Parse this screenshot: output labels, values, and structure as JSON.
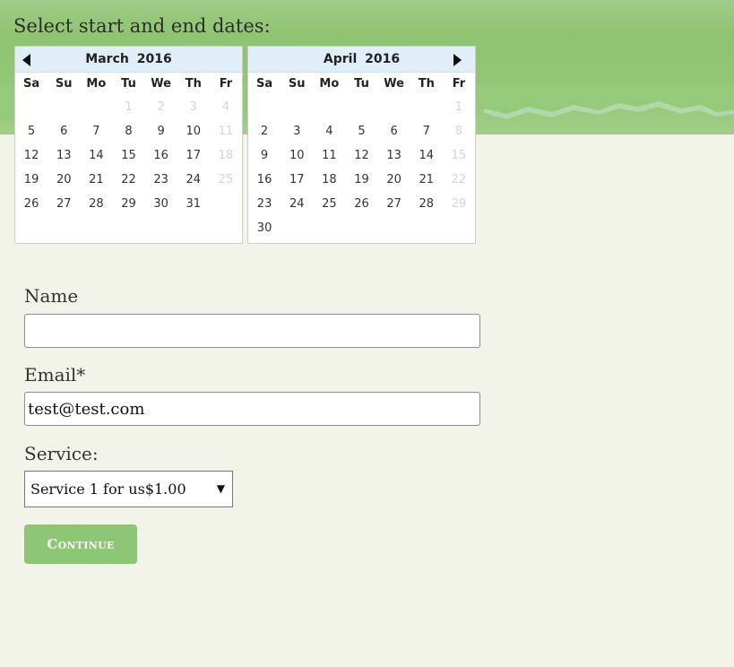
{
  "header": {
    "title": "Select start and end dates:"
  },
  "calendars": [
    {
      "month_label": "March  2016",
      "weekdays": [
        "Sa",
        "Su",
        "Mo",
        "Tu",
        "We",
        "Th",
        "Fr"
      ],
      "rows": [
        [
          {
            "t": "",
            "s": "empty"
          },
          {
            "t": "",
            "s": "empty"
          },
          {
            "t": "",
            "s": "empty"
          },
          {
            "t": "1",
            "s": "dim"
          },
          {
            "t": "2",
            "s": "dim"
          },
          {
            "t": "3",
            "s": "dim"
          },
          {
            "t": "4",
            "s": "dim"
          }
        ],
        [
          {
            "t": "5",
            "s": ""
          },
          {
            "t": "6",
            "s": ""
          },
          {
            "t": "7",
            "s": ""
          },
          {
            "t": "8",
            "s": ""
          },
          {
            "t": "9",
            "s": ""
          },
          {
            "t": "10",
            "s": ""
          },
          {
            "t": "11",
            "s": "dim"
          }
        ],
        [
          {
            "t": "12",
            "s": ""
          },
          {
            "t": "13",
            "s": ""
          },
          {
            "t": "14",
            "s": ""
          },
          {
            "t": "15",
            "s": ""
          },
          {
            "t": "16",
            "s": ""
          },
          {
            "t": "17",
            "s": ""
          },
          {
            "t": "18",
            "s": "dim"
          }
        ],
        [
          {
            "t": "19",
            "s": ""
          },
          {
            "t": "20",
            "s": ""
          },
          {
            "t": "21",
            "s": ""
          },
          {
            "t": "22",
            "s": ""
          },
          {
            "t": "23",
            "s": ""
          },
          {
            "t": "24",
            "s": ""
          },
          {
            "t": "25",
            "s": "dim"
          }
        ],
        [
          {
            "t": "26",
            "s": ""
          },
          {
            "t": "27",
            "s": ""
          },
          {
            "t": "28",
            "s": ""
          },
          {
            "t": "29",
            "s": ""
          },
          {
            "t": "30",
            "s": ""
          },
          {
            "t": "31",
            "s": ""
          },
          {
            "t": "",
            "s": "empty"
          }
        ],
        [
          {
            "t": "",
            "s": "empty"
          },
          {
            "t": "",
            "s": "empty"
          },
          {
            "t": "",
            "s": "empty"
          },
          {
            "t": "",
            "s": "empty"
          },
          {
            "t": "",
            "s": "empty"
          },
          {
            "t": "",
            "s": "empty"
          },
          {
            "t": "",
            "s": "empty"
          }
        ]
      ]
    },
    {
      "month_label": "April  2016",
      "weekdays": [
        "Sa",
        "Su",
        "Mo",
        "Tu",
        "We",
        "Th",
        "Fr"
      ],
      "rows": [
        [
          {
            "t": "",
            "s": "empty"
          },
          {
            "t": "",
            "s": "empty"
          },
          {
            "t": "",
            "s": "empty"
          },
          {
            "t": "",
            "s": "empty"
          },
          {
            "t": "",
            "s": "empty"
          },
          {
            "t": "",
            "s": "empty"
          },
          {
            "t": "1",
            "s": "dim"
          }
        ],
        [
          {
            "t": "2",
            "s": ""
          },
          {
            "t": "3",
            "s": ""
          },
          {
            "t": "4",
            "s": ""
          },
          {
            "t": "5",
            "s": ""
          },
          {
            "t": "6",
            "s": ""
          },
          {
            "t": "7",
            "s": ""
          },
          {
            "t": "8",
            "s": "dim"
          }
        ],
        [
          {
            "t": "9",
            "s": ""
          },
          {
            "t": "10",
            "s": ""
          },
          {
            "t": "11",
            "s": ""
          },
          {
            "t": "12",
            "s": ""
          },
          {
            "t": "13",
            "s": ""
          },
          {
            "t": "14",
            "s": ""
          },
          {
            "t": "15",
            "s": "dim"
          }
        ],
        [
          {
            "t": "16",
            "s": ""
          },
          {
            "t": "17",
            "s": ""
          },
          {
            "t": "18",
            "s": ""
          },
          {
            "t": "19",
            "s": ""
          },
          {
            "t": "20",
            "s": ""
          },
          {
            "t": "21",
            "s": ""
          },
          {
            "t": "22",
            "s": "dim"
          }
        ],
        [
          {
            "t": "23",
            "s": ""
          },
          {
            "t": "24",
            "s": ""
          },
          {
            "t": "25",
            "s": ""
          },
          {
            "t": "26",
            "s": ""
          },
          {
            "t": "27",
            "s": ""
          },
          {
            "t": "28",
            "s": ""
          },
          {
            "t": "29",
            "s": "dim"
          }
        ],
        [
          {
            "t": "30",
            "s": ""
          },
          {
            "t": "",
            "s": "empty"
          },
          {
            "t": "",
            "s": "empty"
          },
          {
            "t": "",
            "s": "empty"
          },
          {
            "t": "",
            "s": "empty"
          },
          {
            "t": "",
            "s": "empty"
          },
          {
            "t": "",
            "s": "empty"
          }
        ]
      ]
    }
  ],
  "form": {
    "name_label": "Name",
    "name_value": "",
    "email_label": "Email*",
    "email_value": "test@test.com",
    "service_label": "Service:",
    "service_selected": "Service 1 for us$1.00",
    "continue_label": "Continue"
  },
  "icons": {
    "prev": "arrow-left-icon",
    "next": "arrow-right-icon",
    "dropdown": "chevron-down-icon"
  },
  "colors": {
    "accent_green": "#8dc674",
    "calendar_header": "#dfeef8",
    "page_background": "#f2f4ea"
  }
}
